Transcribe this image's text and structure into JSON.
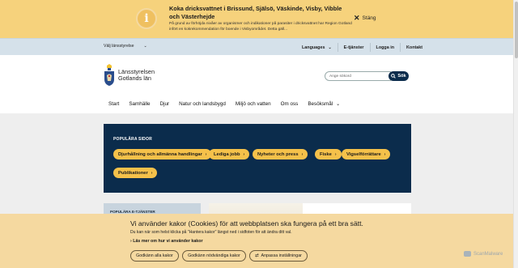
{
  "alert": {
    "title": "Koka dricksvattnet i Brissund, Själsö, Väskinde, Visby, Vibble och Västerhejde",
    "text": "På grund av förhöjda nivåer av organismer och indikationer på parasiter i dricksvattnet har Region Gotland infört en kokrekommendation för boende i Visbyområdet. Detta gäll...",
    "close_label": "Stäng",
    "icon": "info-icon"
  },
  "utility": {
    "county_select": "Välj länsstyrelse",
    "links": [
      "Languages",
      "E-tjänster",
      "Logga in",
      "Kontakt"
    ]
  },
  "logo": {
    "line1": "Länsstyrelsen",
    "line2": "Gotlands län"
  },
  "search": {
    "placeholder": "Ange sökord",
    "button": "Sök"
  },
  "nav": [
    "Start",
    "Samhälle",
    "Djur",
    "Natur och landsbygd",
    "Miljö och vatten",
    "Om oss",
    "Besöksmål"
  ],
  "popular": {
    "heading": "POPULÄRA SIDOR",
    "pills": [
      "Djurhållning och allmänna handlingar",
      "Lediga jobb",
      "Nyheter och press",
      "Fiske",
      "Vigselförrättare",
      "Publikationer"
    ]
  },
  "eservices": {
    "heading": "POPULÄRA E-TJÄNSTER"
  },
  "cookie": {
    "title": "Vi använder kakor (Cookies) för att webbplatsen ska fungera på ett bra sätt.",
    "text": "Du kan när som helst klicka på \"Hantera kakor\" längst ned i sidfoten för att ändra ditt val.",
    "more": "Läs mer om hur vi använder kakor",
    "buttons": [
      "Godkänn alla kakor",
      "Godkänn nödvändiga kakor",
      "Anpassa inställningar"
    ]
  },
  "watermark": "ScanMalware",
  "colors": {
    "alert_bg": "#f6d27c",
    "navy": "#0b2c4c",
    "pill": "#f5c14a",
    "cookie_bg": "#f5d9a0"
  }
}
